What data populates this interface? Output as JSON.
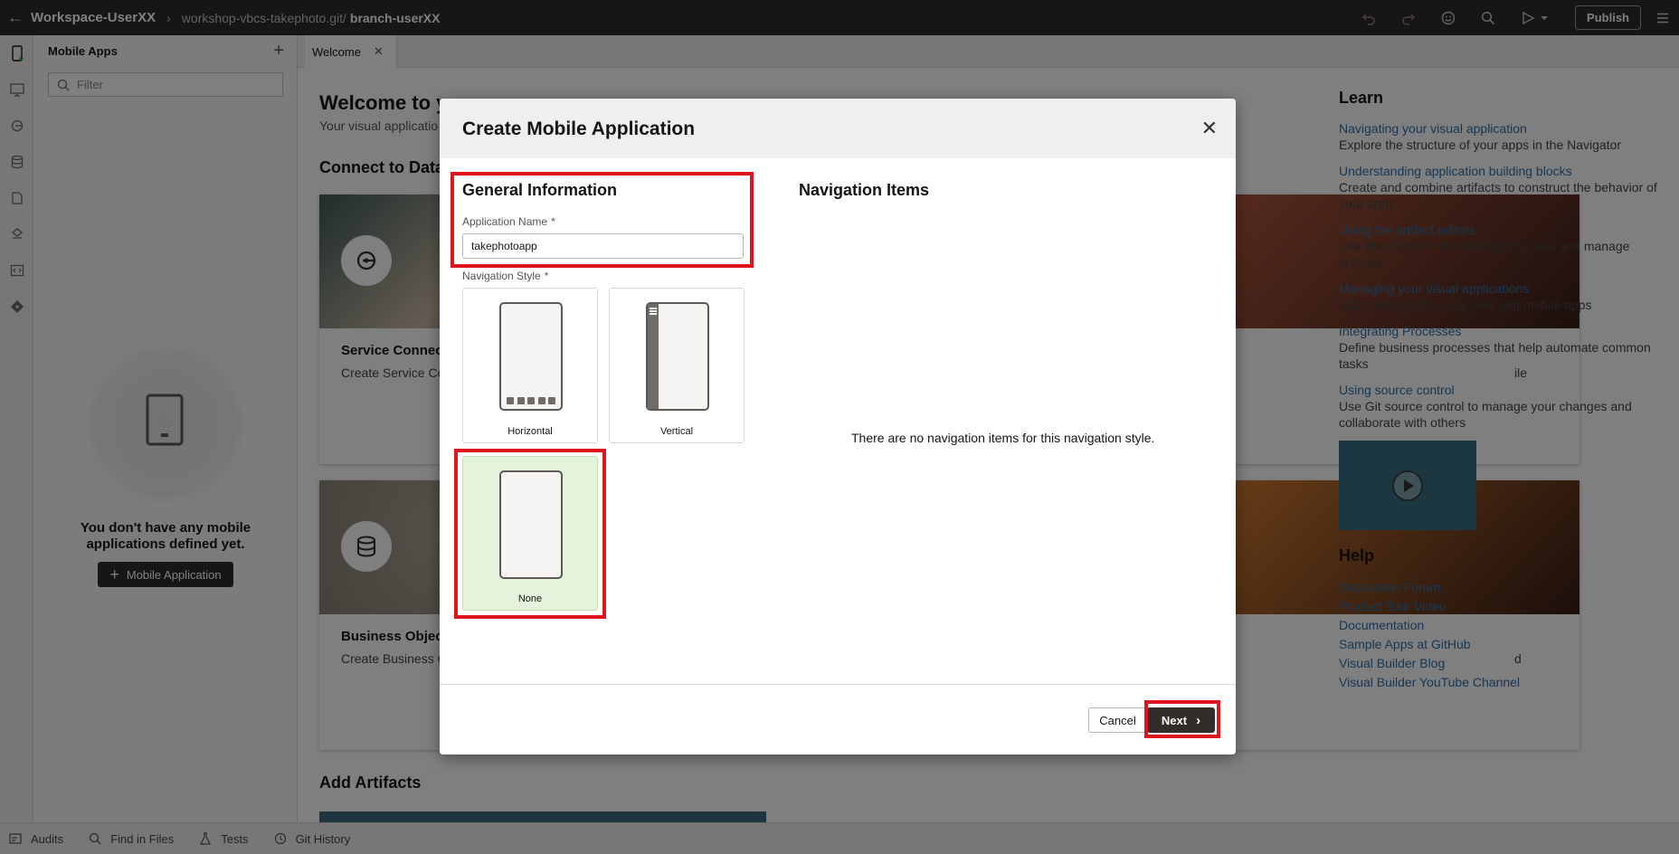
{
  "topbar": {
    "workspace": "Workspace-UserXX",
    "repo": "workshop-vbcs-takephoto.git/",
    "branch": "branch-userXX",
    "publish_label": "Publish"
  },
  "sidepanel": {
    "title": "Mobile Apps",
    "filter_placeholder": "Filter",
    "empty_text": "You don't have any mobile applications defined yet.",
    "add_button_label": "Mobile Application"
  },
  "tabs": [
    {
      "label": "Welcome"
    }
  ],
  "welcome": {
    "title": "Welcome to y",
    "subtitle": "Your visual applicatio",
    "connect_heading": "Connect to Data",
    "cards": [
      {
        "title": "Service Connec",
        "desc": "Create Service Co provided by a ser"
      },
      {
        "title": "Business Objec",
        "desc": "Create Business C database based o"
      }
    ],
    "card_fragments": [
      "ile",
      "d"
    ],
    "add_artifacts_heading": "Add Artifacts"
  },
  "learn": {
    "heading": "Learn",
    "items": [
      {
        "link": "Navigating your visual application",
        "desc": "Explore the structure of your apps in the Navigator"
      },
      {
        "link": "Understanding application building blocks",
        "desc": "Create and combine artifacts to construct the behavior of your apps"
      },
      {
        "link": "Using the artifact editors",
        "desc": "Use the editors in the Designer to view and manage artifacts"
      },
      {
        "link": "Managing your visual applications",
        "desc": "Stage and publish your web and mobile apps"
      },
      {
        "link": "Integrating Processes",
        "desc": "Define business processes that help automate common tasks"
      },
      {
        "link": "Using source control",
        "desc": "Use Git source control to manage your changes and collaborate with others"
      }
    ]
  },
  "help": {
    "heading": "Help",
    "links": [
      "Discussion Forum",
      "Product Tour Video",
      "Documentation",
      "Sample Apps at GitHub",
      "Visual Builder Blog",
      "Visual Builder YouTube Channel"
    ]
  },
  "bottombar": {
    "items": [
      "Audits",
      "Find in Files",
      "Tests",
      "Git History"
    ]
  },
  "dialog": {
    "title": "Create Mobile Application",
    "general_heading": "General Information",
    "app_name_label": "Application Name",
    "app_name_value": "takephotoapp",
    "nav_style_label": "Navigation Style",
    "required_mark": "*",
    "nav_options": [
      {
        "label": "Horizontal",
        "selected": false
      },
      {
        "label": "Vertical",
        "selected": false
      },
      {
        "label": "None",
        "selected": true
      }
    ],
    "nav_items_heading": "Navigation Items",
    "nav_items_empty": "There are no navigation items for this navigation style.",
    "cancel_label": "Cancel",
    "next_label": "Next"
  },
  "colors": {
    "topbar_bg": "#312d2a",
    "selected_option_bg": "#e3f3dc",
    "highlight": "#e0141e",
    "link": "#2e6ea6"
  }
}
